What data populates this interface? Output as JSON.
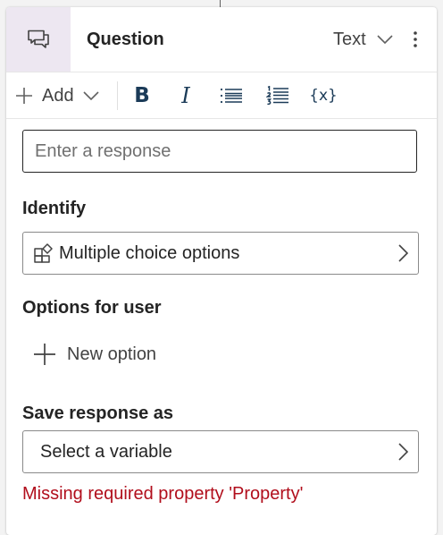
{
  "node": {
    "title": "Question",
    "type_label": "Text",
    "icon": "chat-bubbles-icon"
  },
  "toolbar": {
    "add_label": "Add",
    "bold": "B",
    "italic": "I",
    "bullet_list": "bullet-list-icon",
    "numbered_list": "numbered-list-icon",
    "variable": "{x}"
  },
  "response": {
    "placeholder": "Enter a response",
    "value": ""
  },
  "identify": {
    "label": "Identify",
    "value": "Multiple choice options"
  },
  "options": {
    "label": "Options for user",
    "new_option_label": "New option"
  },
  "save": {
    "label": "Save response as",
    "placeholder": "Select a variable",
    "error": "Missing required property 'Property'"
  },
  "colors": {
    "accent_bg": "#ede7f1",
    "error": "#b10e1c",
    "toolbar_icon": "#1b3b58"
  }
}
